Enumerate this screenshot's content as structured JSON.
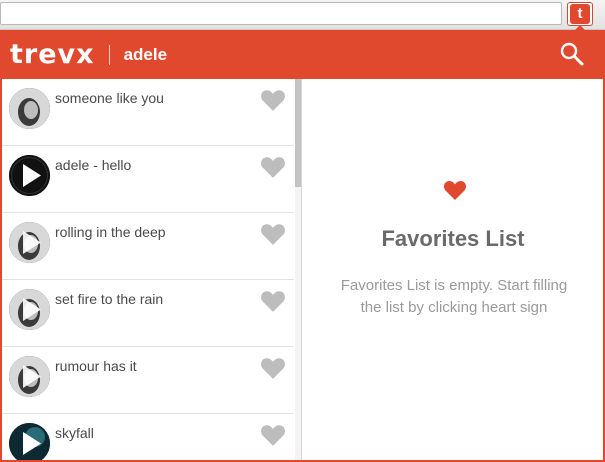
{
  "brand": {
    "name": "trevx",
    "extension_letter": "t",
    "accent": "#e0492e"
  },
  "search": {
    "query": "adele"
  },
  "results": [
    {
      "title": "someone like you",
      "thumb": "portrait-photo"
    },
    {
      "title": "adele - hello",
      "thumb": "play-icon"
    },
    {
      "title": "rolling in the deep",
      "thumb": "portrait-photo-play"
    },
    {
      "title": "set fire to the rain",
      "thumb": "portrait-photo-play"
    },
    {
      "title": "rumour has it",
      "thumb": "portrait-photo-play"
    },
    {
      "title": "skyfall",
      "thumb": "dark-photo-play"
    }
  ],
  "favorites": {
    "title": "Favorites List",
    "empty_message": "Favorites List is empty. Start filling the list by clicking heart sign"
  },
  "icons": {
    "search": "search-icon",
    "favorite": "heart-icon",
    "play": "play-icon"
  },
  "colors": {
    "heart_inactive": "#bdbdbd",
    "heart_active": "#e0492e"
  }
}
